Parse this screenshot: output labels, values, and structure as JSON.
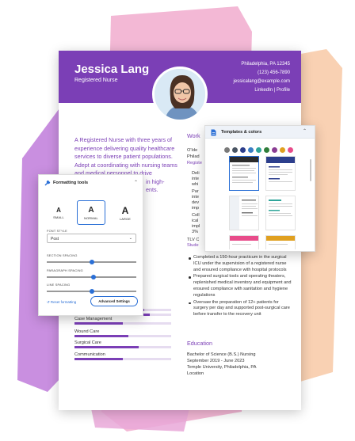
{
  "resume": {
    "name": "Jessica Lang",
    "title": "Registered Nurse",
    "contact": [
      "Philadelphia, PA 12345",
      "(123) 456-7890",
      "jessicalang@example.com",
      "LinkedIn | Profile"
    ],
    "summary": "A Registered Nurse with three years of experience delivering quality healthcare services to diverse patient populations. Adept at coordinating with nursing teams and medical personnel to drive",
    "summary_partial_1": "in high-",
    "summary_partial_2": "ents.",
    "work_heading": "Work",
    "work_fragments": [
      "O'Ide",
      "Philad",
      "Registe",
      "Deli",
      "inte",
      "whi",
      "Par",
      "inte",
      "dev",
      "imp",
      "Coll",
      "ical",
      "impl",
      "3%",
      "TLV C",
      "Stude"
    ],
    "bullets": [
      "Completed a 150-hour practicum in the surgical ICU under the supervision of a registered nurse and ensured compliance with hospital protocols",
      "Prepared surgical tools and operating theaters, replenished medical inventory and equipment and ensured compliance with sanitation and hygiene regulations",
      "Oversaw the preparation of 12+ patients for surgery per day and supported post-surgical care before transfer to the recovery unit"
    ],
    "education_heading": "Education",
    "education": [
      "Bachelor of Science (B.S.) Nursing",
      "September 2019 - June 2023",
      "Temple University, Philadelphia, PA",
      "Location"
    ],
    "skills": [
      {
        "label": "Case Management",
        "level": 0.5
      },
      {
        "label": "Wound Care",
        "level": 0.56
      },
      {
        "label": "Surgical Care",
        "level": 0.66
      },
      {
        "label": "Communication",
        "level": 0.5
      }
    ],
    "top_bar_levels": [
      0.72,
      0.78
    ]
  },
  "formatting": {
    "title": "Formatting tools",
    "sizes": [
      {
        "glyph": "A",
        "label": "SMALL"
      },
      {
        "glyph": "A",
        "label": "NORMAL",
        "selected": true
      },
      {
        "glyph": "A",
        "label": "LARGE"
      }
    ],
    "font_style_label": "FONT STYLE",
    "font_value": "Post",
    "section_spacing_label": "SECTION SPACING",
    "section_spacing": 0.5,
    "paragraph_spacing_label": "PARAGRAPH SPACING",
    "paragraph_spacing": 0.52,
    "line_spacing_label": "LINE SPACING",
    "line_spacing": 0.5,
    "reset_label": "Reset formatting",
    "advanced_label": "Advanced Settings"
  },
  "templates": {
    "title": "Templates & colors",
    "colors": [
      "#7a7a7a",
      "#4a5563",
      "#2c3e8c",
      "#3c7fc4",
      "#2fa59a",
      "#2f7d3a",
      "#8a3d93",
      "#e0a020",
      "#e84c8a"
    ]
  },
  "colors": {
    "accent": "#7b3fb6",
    "link": "#2a6fd6",
    "pink_shape": "#f2a7c9",
    "orange_shape": "#f5c3a0",
    "violet_shape": "#c58ddb"
  }
}
